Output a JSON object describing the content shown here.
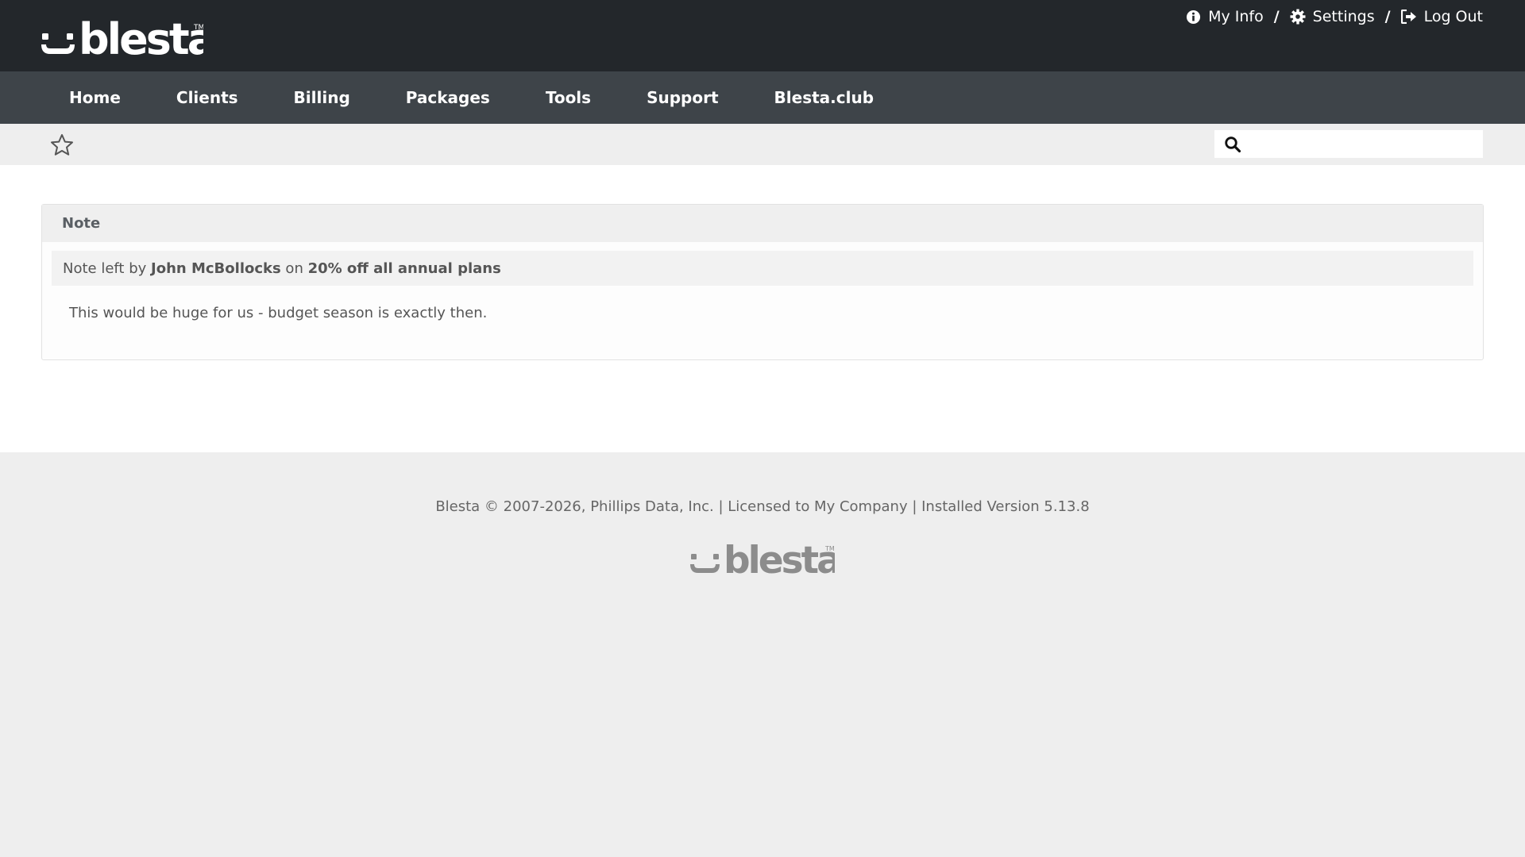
{
  "header": {
    "logo_text": "blesta",
    "user_links": [
      {
        "label": "My Info",
        "icon": "info-circle-icon"
      },
      {
        "label": "Settings",
        "icon": "gear-icon"
      },
      {
        "label": "Log Out",
        "icon": "sign-out-icon"
      }
    ],
    "separator": "/"
  },
  "nav": {
    "items": [
      "Home",
      "Clients",
      "Billing",
      "Packages",
      "Tools",
      "Support",
      "Blesta.club"
    ]
  },
  "subbar": {
    "star_icon": "star-outline-icon",
    "search_icon": "search-icon",
    "search_value": ""
  },
  "note_panel": {
    "title": "Note",
    "meta_prefix": "Note left by ",
    "author": "John McBollocks",
    "meta_on": " on ",
    "subject": "20% off all annual plans",
    "body": "This would be huge for us - budget season is exactly then."
  },
  "footer": {
    "text": "Blesta © 2007-2026, Phillips Data, Inc. | Licensed to My Company | Installed Version 5.13.8",
    "logo_text": "blesta"
  },
  "colors": {
    "topbar": "#23272b",
    "navbar": "#3e4449",
    "page_bg": "#eeeeee",
    "content_bg": "#ffffff"
  }
}
